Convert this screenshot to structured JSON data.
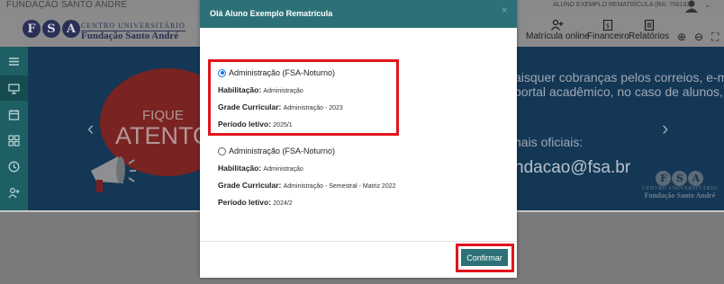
{
  "topbar": {
    "institution": "FUNDAÇÃO SANTO ANDRÉ",
    "user_label": "ALUNO EXEMPLO REMATRÍCULA (RA: 756163)"
  },
  "logo": {
    "letters": [
      "F",
      "S",
      "A"
    ],
    "line1": "CENTRO UNIVERSITÁRIO",
    "line2": "Fundação Santo André"
  },
  "nav": {
    "items": [
      {
        "label": "Matrícula online",
        "icon": "user-plus-icon"
      },
      {
        "label": "Financeiro",
        "icon": "dollar-doc-icon"
      },
      {
        "label": "Relatórios",
        "icon": "report-doc-icon"
      }
    ],
    "tools": [
      "zoom-in-icon",
      "zoom-out-icon",
      "expand-icon"
    ]
  },
  "sidebar": {
    "items": [
      "menu-icon",
      "monitor-icon",
      "calendar-icon",
      "grid-icon",
      "clock-icon",
      "user-add-icon"
    ]
  },
  "banner": {
    "fique": "FIQUE",
    "atento": "ATENTO",
    "text_lines": [
      "aisquer cobranças pelos correios, e-mail,",
      "portal acadêmico, no caso de alunos, ou"
    ],
    "text_oficiais": "nais oficiais:",
    "email": "ndacao@fsa.br",
    "logo_line1": "CENTRO UNIVERSITÁRIO",
    "logo_line2": "Fundação Santo André"
  },
  "modal": {
    "title": "Olá Aluno Exemplo Rematrícula",
    "close": "×",
    "options": [
      {
        "title": "Administração (FSA-Noturno)",
        "checked": true,
        "habilitacao_label": "Habilitação:",
        "habilitacao": "Administração",
        "grade_label": "Grade Curricular:",
        "grade": "Administração - 2023",
        "periodo_label": "Período letivo:",
        "periodo": "2025/1"
      },
      {
        "title": "Administração (FSA-Noturno)",
        "checked": false,
        "habilitacao_label": "Habilitação:",
        "habilitacao": "Administração",
        "grade_label": "Grade Curricular:",
        "grade": "Administração - Semestral - Matriz 2022",
        "periodo_label": "Período letivo:",
        "periodo": "2024/2"
      }
    ],
    "confirm_label": "Confirmar"
  },
  "colors": {
    "teal": "#2d7178",
    "highlight": "#e0151b",
    "sidebar": "#1d5f63",
    "banner": "#143755"
  }
}
